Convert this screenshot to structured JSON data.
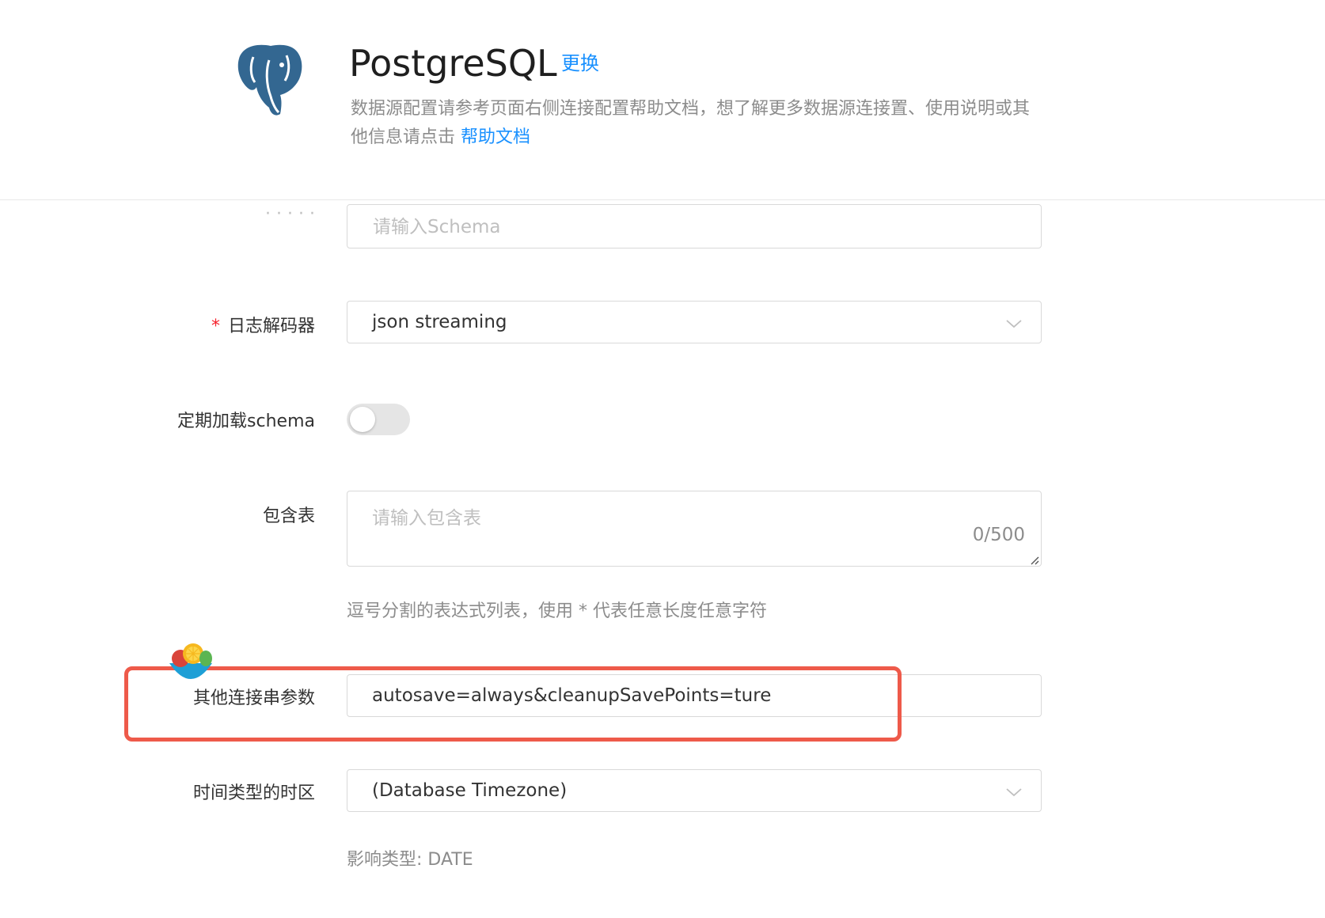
{
  "header": {
    "title": "PostgreSQL",
    "change_label": "更换",
    "description": "数据源配置请参考页面右侧连接配置帮助文档，想了解更多数据源连接置、使用说明或其他信息请点击",
    "help_link": "帮助文档",
    "logo_icon": "postgresql-elephant-icon"
  },
  "form": {
    "schema_placeholder_partial": "请输入Schema",
    "log_decoder": {
      "label": "日志解码器",
      "required_mark": "*",
      "value": "json streaming"
    },
    "periodic_schema_load": {
      "label": "定期加载schema",
      "enabled": false
    },
    "include_tables": {
      "label": "包含表",
      "placeholder": "请输入包含表",
      "counter": "0/500",
      "help": "逗号分割的表达式列表，使用 * 代表任意长度任意字符"
    },
    "extra_params": {
      "label": "其他连接串参数",
      "value": "autosave=always&cleanupSavePoints=ture"
    },
    "timezone": {
      "label": "时间类型的时区",
      "value": "(Database Timezone)",
      "help": "影响类型: DATE"
    }
  },
  "colors": {
    "accent": "#1890ff",
    "required": "#f5222d",
    "highlight_border": "#ee5a4a",
    "logo_blue": "#336791"
  }
}
